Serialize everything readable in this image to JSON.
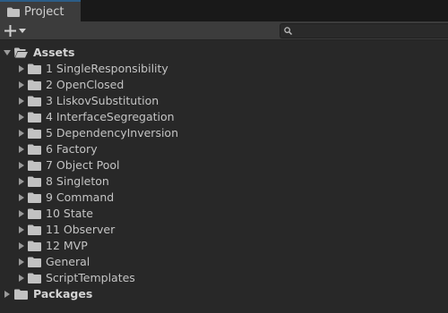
{
  "window": {
    "tab_title": "Project"
  },
  "toolbar": {
    "create_icon": "plus-icon",
    "dropdown_icon": "triangle-down-icon",
    "search_icon": "magnifier-icon",
    "search_value": "",
    "search_placeholder": ""
  },
  "tree": {
    "assets": {
      "label": "Assets",
      "expanded": true,
      "children": [
        {
          "label": "1 SingleResponsibility"
        },
        {
          "label": "2 OpenClosed"
        },
        {
          "label": "3 LiskovSubstitution"
        },
        {
          "label": "4 InterfaceSegregation"
        },
        {
          "label": "5 DependencyInversion"
        },
        {
          "label": "6 Factory"
        },
        {
          "label": "7 Object Pool"
        },
        {
          "label": "8 Singleton"
        },
        {
          "label": "9 Command"
        },
        {
          "label": "10 State"
        },
        {
          "label": "11 Observer"
        },
        {
          "label": "12 MVP"
        },
        {
          "label": "General"
        },
        {
          "label": "ScriptTemplates"
        }
      ]
    },
    "packages": {
      "label": "Packages",
      "expanded": false
    }
  },
  "colors": {
    "panel_bg": "#282828",
    "toolbar_bg": "#3c3c3c",
    "folder": "#c2c2c2",
    "text": "#c4c4c4",
    "tab_accent": "#2c5d87"
  }
}
